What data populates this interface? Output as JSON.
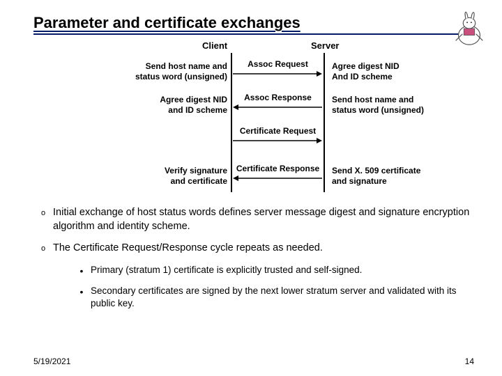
{
  "title": "Parameter and certificate exchanges",
  "diagram": {
    "client_label": "Client",
    "server_label": "Server",
    "rows": [
      {
        "left": "Send host name and\nstatus word (unsigned)",
        "mid": "Assoc Request",
        "right": "Agree digest NID\nAnd ID scheme",
        "dir": "right"
      },
      {
        "left": "Agree digest NID\nand ID scheme",
        "mid": "Assoc Response",
        "right": "Send host name and\nstatus word (unsigned)",
        "dir": "left"
      },
      {
        "left": "",
        "mid": "Certificate Request",
        "right": "",
        "dir": "right"
      },
      {
        "left": "Verify signature\nand certificate",
        "mid": "Certificate Response",
        "right": "Send X. 509 certificate\nand signature",
        "dir": "left"
      }
    ]
  },
  "bullets": [
    "Initial exchange of host status words defines server message digest and signature encryption algorithm and identity scheme.",
    "The Certificate Request/Response cycle repeats as needed."
  ],
  "subbullets": [
    "Primary (stratum 1) certificate is explicitly trusted and self-signed.",
    "Secondary certificates are signed by the next lower stratum server and validated with its public key."
  ],
  "footer": {
    "date": "5/19/2021",
    "page": "14"
  }
}
